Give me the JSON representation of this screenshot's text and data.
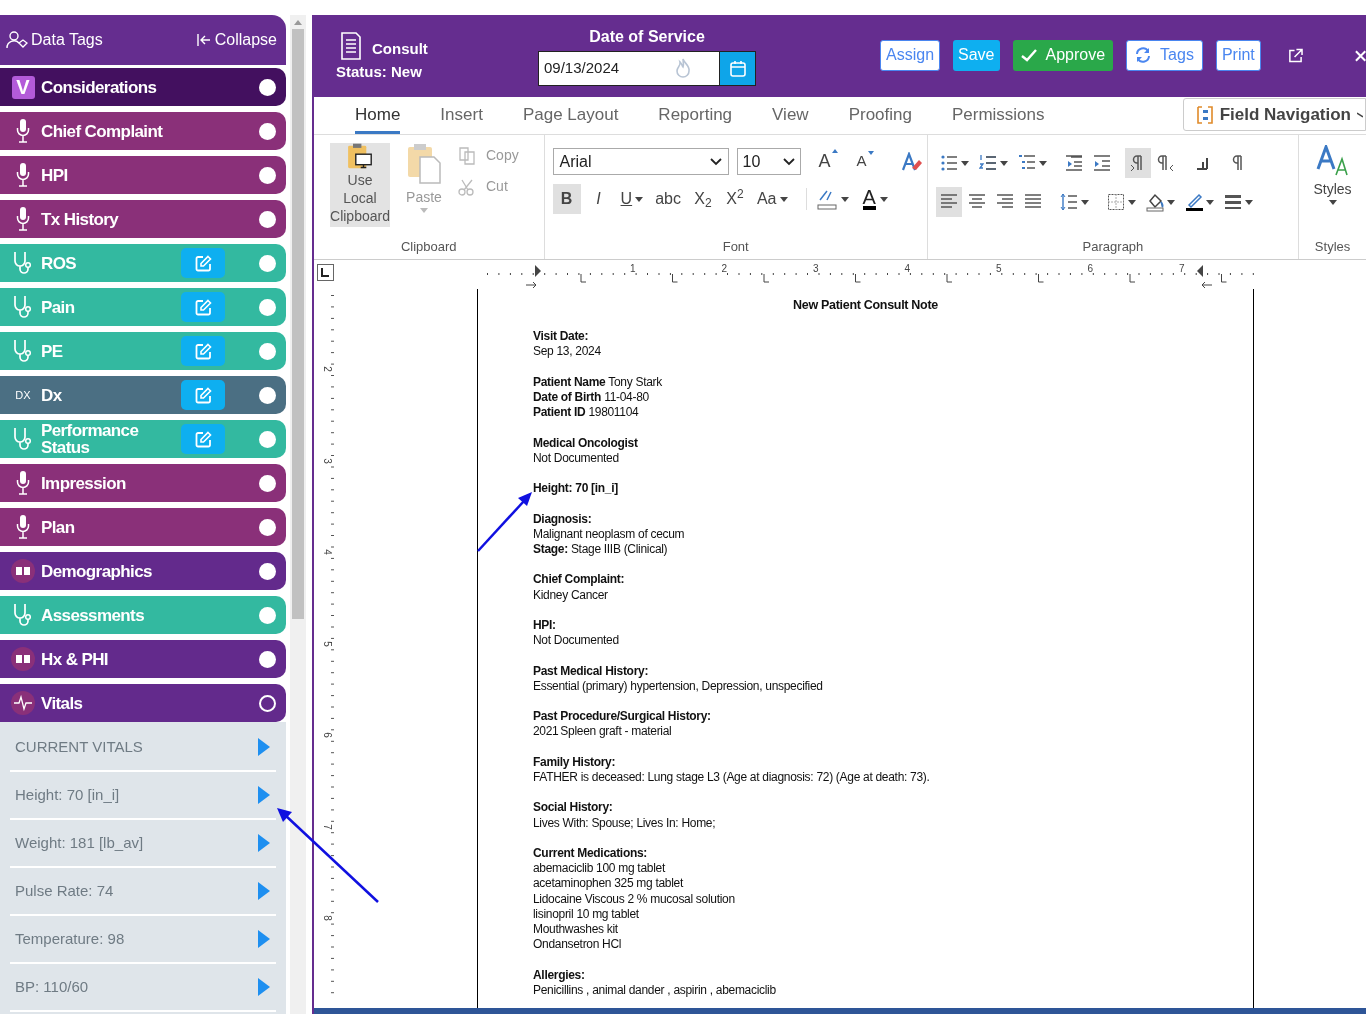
{
  "sidebar": {
    "title": "Data Tags",
    "collapse": "Collapse",
    "items": [
      {
        "label": "Considerations",
        "kind": "considerations",
        "badge": "V",
        "editable": false,
        "on": true
      },
      {
        "label": "Chief Complaint",
        "kind": "mic",
        "editable": false,
        "on": true
      },
      {
        "label": "HPI",
        "kind": "mic",
        "editable": false,
        "on": true
      },
      {
        "label": "Tx History",
        "kind": "mic",
        "editable": false,
        "on": true
      },
      {
        "label": "ROS",
        "kind": "stethoscope",
        "editable": true,
        "on": true
      },
      {
        "label": "Pain",
        "kind": "stethoscope",
        "editable": true,
        "on": true
      },
      {
        "label": "PE",
        "kind": "stethoscope",
        "editable": true,
        "on": true
      },
      {
        "label": "Dx",
        "kind": "dx",
        "badge": "DX",
        "editable": true,
        "on": true
      },
      {
        "label": "Performance Status",
        "kind": "stethoscope",
        "editable": true,
        "on": true
      },
      {
        "label": "Impression",
        "kind": "mic",
        "editable": false,
        "on": true
      },
      {
        "label": "Plan",
        "kind": "mic",
        "editable": false,
        "on": true
      },
      {
        "label": "Demographics",
        "kind": "book",
        "editable": false,
        "on": true
      },
      {
        "label": "Assessments",
        "kind": "stethoscope",
        "editable": false,
        "on": true
      },
      {
        "label": "Hx & PHI",
        "kind": "book",
        "editable": false,
        "on": true
      },
      {
        "label": "Vitals",
        "kind": "vitals",
        "editable": false,
        "on": false
      }
    ],
    "vitals_list": [
      "CURRENT VITALS",
      "Height: 70 [in_i]",
      "Weight: 181 [lb_av]",
      "Pulse Rate: 74",
      "Temperature: 98",
      "BP: 110/60"
    ]
  },
  "header": {
    "title": "Consult",
    "status": "Status: New",
    "date_label": "Date of Service",
    "date_value": "09/13/2024",
    "buttons": [
      {
        "label": "Assign",
        "kind": "outline"
      },
      {
        "label": "Save",
        "kind": "primary"
      },
      {
        "label": "Approve",
        "kind": "success"
      },
      {
        "label": "Tags",
        "kind": "outline_refresh"
      },
      {
        "label": "Print",
        "kind": "outline"
      }
    ]
  },
  "ribbon": {
    "tabs": [
      {
        "label": "Home",
        "selected": true
      },
      {
        "label": "Insert",
        "selected": false
      },
      {
        "label": "Page Layout",
        "selected": false
      },
      {
        "label": "Reporting",
        "selected": false
      },
      {
        "label": "View",
        "selected": false
      },
      {
        "label": "Proofing",
        "selected": false
      },
      {
        "label": "Permissions",
        "selected": false
      }
    ],
    "field_navigation": "Field Navigation",
    "clipboard": {
      "label": "Clipboard",
      "local": {
        "label": "Use Local Clipboard",
        "selected": true
      },
      "paste": {
        "label": "Paste",
        "disabled": true
      },
      "copy": {
        "label": "Copy",
        "disabled": true
      },
      "cut": {
        "label": "Cut",
        "disabled": true
      }
    },
    "font": {
      "label": "Font",
      "family": "Arial",
      "size": "10",
      "grow": "A",
      "shrink": "A",
      "format_buttons": [
        {
          "label": "B",
          "selected": true,
          "caret": false
        },
        {
          "label": "I",
          "selected": false,
          "caret": false
        },
        {
          "label": "U",
          "selected": false,
          "caret": true
        },
        {
          "label": "abc",
          "selected": false,
          "caret": false
        },
        {
          "label": "X$_{2}$",
          "selected": false,
          "caret": false
        },
        {
          "label": "X$^{2}$",
          "selected": false,
          "caret": false
        },
        {
          "label": "Aa",
          "selected": false,
          "caret": true
        }
      ],
      "color_button": "A"
    },
    "paragraph": {
      "label": "Paragraph",
      "row1": [
        {
          "kind": "bullets",
          "selected": false
        },
        {
          "kind": "numbering",
          "selected": false
        },
        {
          "kind": "multilevel",
          "selected": false
        },
        {
          "kind": "outdent",
          "selected": false
        },
        {
          "kind": "indent",
          "selected": false
        },
        {
          "kind": "pilcrow_ltr",
          "selected": true
        },
        {
          "kind": "pilcrow_rtl",
          "selected": false
        },
        {
          "kind": "tab",
          "selected": false
        },
        {
          "kind": "pilcrow",
          "selected": false
        }
      ],
      "row2": [
        {
          "kind": "align_left",
          "selected": true
        },
        {
          "kind": "align_center",
          "selected": false
        },
        {
          "kind": "align_right",
          "selected": false
        },
        {
          "kind": "justify",
          "selected": false
        },
        {
          "kind": "line_spacing",
          "selected": false
        },
        {
          "kind": "borders",
          "selected": false
        },
        {
          "kind": "shading",
          "selected": false
        },
        {
          "kind": "border_color",
          "selected": false
        },
        {
          "kind": "border_style",
          "selected": false
        }
      ]
    },
    "styles": {
      "button": "Styles",
      "label": "Styles"
    }
  },
  "ruler": {
    "h_marks": [
      "1",
      "2",
      "3",
      "4",
      "5",
      "6",
      "7"
    ],
    "v_marks": [
      "2",
      "3",
      "4",
      "5",
      "6",
      "7",
      "8"
    ]
  },
  "document": {
    "title": "New Patient Consult Note",
    "sections": [
      {
        "heading": "Visit Date:",
        "lines": [
          "Sep 13, 2024"
        ]
      },
      {
        "lines": [
          "**Patient Name** Tony Stark",
          "**Date of Birth** 11-04-80",
          "**Patient ID** 19801104"
        ]
      },
      {
        "heading": "Medical Oncologist",
        "lines": [
          "Not Documented"
        ]
      },
      {
        "heading": "Height: 70 [in_i]"
      },
      {
        "heading": "Diagnosis:",
        "lines": [
          "Malignant neoplasm of cecum",
          "**Stage:** Stage IIIB (Clinical)"
        ]
      },
      {
        "heading": "Chief Complaint:",
        "lines": [
          "Kidney Cancer"
        ]
      },
      {
        "heading": "HPI:",
        "lines": [
          "Not Documented"
        ]
      },
      {
        "heading": "Past Medical History:",
        "lines": [
          "Essential (primary) hypertension, Depression, unspecified"
        ]
      },
      {
        "heading": "Past Procedure/Surgical History:",
        "lines": [
          "2021\tSpleen graft - material"
        ]
      },
      {
        "heading": "Family History:",
        "lines": [
          "FATHER is deceased: Lung stage L3 (Age at diagnosis: 72) (Age at death: 73)."
        ]
      },
      {
        "heading": "Social History:",
        "lines": [
          "Lives With: Spouse; Lives In: Home;"
        ]
      },
      {
        "heading": "Current Medications:",
        "lines": [
          "abemaciclib 100 mg tablet",
          "acetaminophen 325 mg tablet",
          "Lidocaine Viscous 2 % mucosal solution",
          "lisinopril 10 mg tablet",
          "Mouthwashes kit",
          "Ondansetron HCl"
        ]
      },
      {
        "heading": "Allergies:",
        "lines": [
          "Penicillins , animal dander , aspirin , abemaciclib"
        ]
      }
    ]
  }
}
